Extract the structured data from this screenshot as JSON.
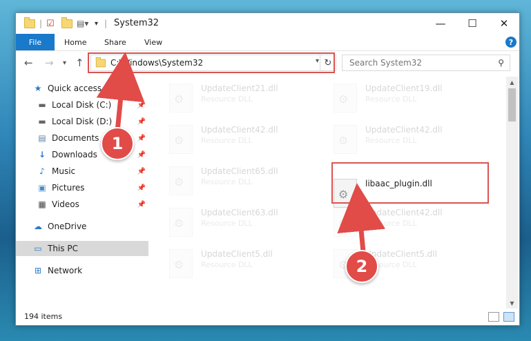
{
  "window": {
    "title": "System32",
    "controls": {
      "minimize": "—",
      "maximize": "☐",
      "close": "✕"
    }
  },
  "ribbon": {
    "tabs": [
      "File",
      "Home",
      "Share",
      "View"
    ],
    "help": "?"
  },
  "address": {
    "path": "C:\\Windows\\System32",
    "search_placeholder": "Search System32"
  },
  "nav": {
    "quick_access": "Quick access",
    "items": [
      {
        "label": "Local Disk (C:)",
        "icon": "drive-icon"
      },
      {
        "label": "Local Disk (D:)",
        "icon": "drive-icon"
      },
      {
        "label": "Documents",
        "icon": "documents-icon"
      },
      {
        "label": "Downloads",
        "icon": "downloads-icon"
      },
      {
        "label": "Music",
        "icon": "music-icon"
      },
      {
        "label": "Pictures",
        "icon": "pictures-icon"
      },
      {
        "label": "Videos",
        "icon": "videos-icon"
      }
    ],
    "onedrive": "OneDrive",
    "this_pc": "This PC",
    "network": "Network"
  },
  "files": [
    {
      "name": "UpdateClient21.dll",
      "type": "Resource DLL"
    },
    {
      "name": "UpdateClient19.dll",
      "type": "Resource DLL"
    },
    {
      "name": "UpdateClient42.dll",
      "type": "Resource DLL"
    },
    {
      "name": "UpdateClient42.dll",
      "type": "Resource DLL"
    },
    {
      "name": "UpdateClient65.dll",
      "type": "Resource DLL"
    },
    {
      "name": "libaac_plugin.dll",
      "type": ""
    },
    {
      "name": "UpdateClient63.dll",
      "type": "Resource DLL"
    },
    {
      "name": "UpdateClient42.dll",
      "type": "Resource DLL"
    },
    {
      "name": "UpdateClient5.dll",
      "type": "Resource DLL"
    },
    {
      "name": "UpdateClient5.dll",
      "type": "Resource DLL"
    }
  ],
  "status": {
    "item_count": "194 items"
  },
  "markers": {
    "step1": "1",
    "step2": "2"
  },
  "colors": {
    "accent": "#1979ca",
    "highlight": "#d9534f",
    "marker": "#e14b48"
  }
}
